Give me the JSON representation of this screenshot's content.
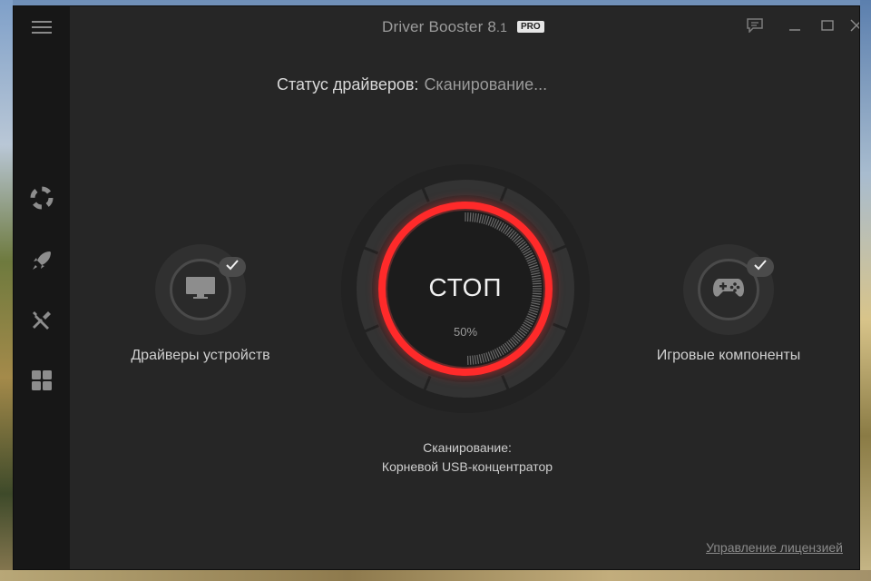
{
  "app": {
    "title": "Driver Booster 8",
    "version_suffix": ".1",
    "badge": "PRO"
  },
  "sidebar": {
    "items": [
      {
        "icon": "menu-icon"
      },
      {
        "icon": "lifebuoy-icon"
      },
      {
        "icon": "rocket-icon"
      },
      {
        "icon": "tools-icon"
      },
      {
        "icon": "apps-grid-icon"
      }
    ]
  },
  "titlebar": {
    "icons": [
      "feedback-icon",
      "minimize-icon",
      "maximize-icon",
      "close-icon"
    ]
  },
  "status": {
    "label": "Статус драйверов:",
    "value": "Сканирование..."
  },
  "left_module": {
    "label": "Драйверы устройств",
    "icon": "monitor-icon",
    "checked": true
  },
  "right_module": {
    "label": "Игровые компоненты",
    "icon": "gamepad-icon",
    "checked": true
  },
  "scan_button": {
    "label": "СТОП",
    "progress_text": "50%",
    "progress": 0.5,
    "accent": "#ff2a2a"
  },
  "scan_caption": {
    "line1": "Сканирование:",
    "line2": "Корневой USB-концентратор"
  },
  "footer": {
    "license_link": "Управление лицензией"
  },
  "colors": {
    "window_bg": "#262626",
    "sidebar_bg": "#171717",
    "accent_red": "#ff2a2a"
  }
}
